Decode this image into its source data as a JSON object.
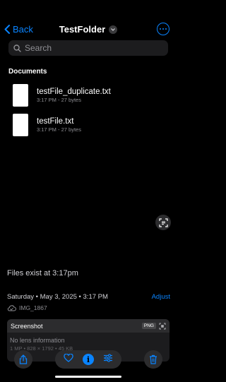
{
  "nav": {
    "back_label": "Back",
    "title": "TestFolder"
  },
  "search": {
    "placeholder": "Search"
  },
  "section_title": "Documents",
  "files": [
    {
      "name": "testFile_duplicate.txt",
      "meta": "3:17 PM - 27 bytes"
    },
    {
      "name": "testFile.txt",
      "meta": "3:17 PM - 27 bytes"
    }
  ],
  "photo_caption": "Files exist at 3:17pm",
  "info": {
    "date": "Saturday • May 3, 2025 • 3:17 PM",
    "adjust_label": "Adjust",
    "image_name": "IMG_1867",
    "card_title": "Screenshot",
    "format_badge": "PNG",
    "lens": "No lens information",
    "dims": "1 MP • 828 × 1792 • 45 KB"
  },
  "colors": {
    "accent": "#0a84ff",
    "background": "#000000"
  },
  "icons": {
    "back": "chevron-left-icon",
    "more": "ellipsis-circle-icon",
    "search": "magnifier-icon",
    "scan": "live-text-icon",
    "cloud": "cloud-icon",
    "share": "share-icon",
    "favorite": "heart-icon",
    "info": "info-icon",
    "edit": "sliders-icon",
    "delete": "trash-icon"
  }
}
